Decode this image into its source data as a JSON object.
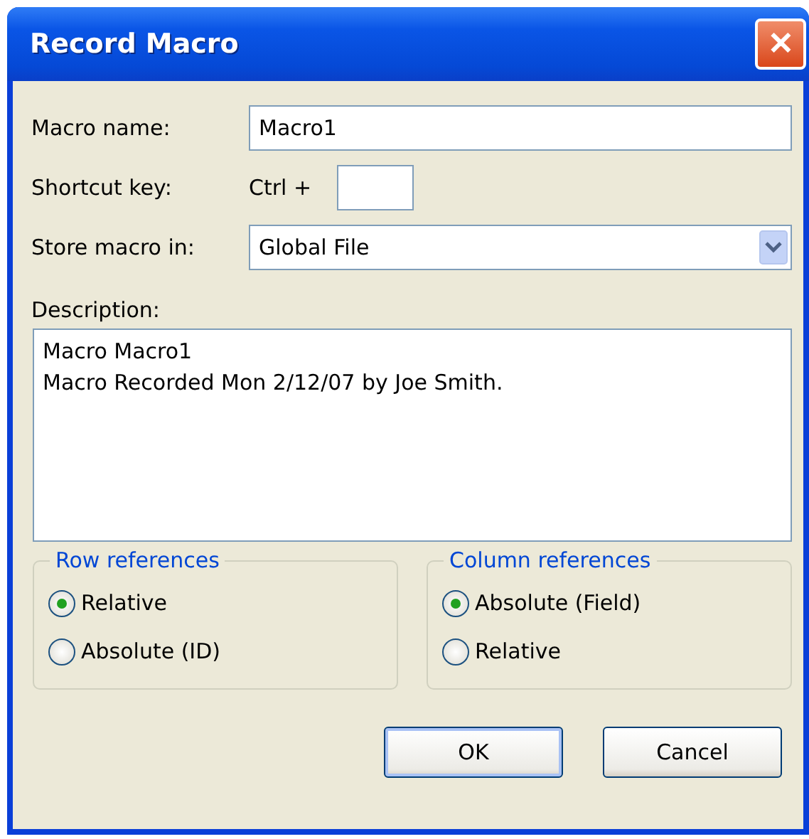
{
  "window": {
    "title": "Record Macro",
    "close": "✕"
  },
  "macro_name": {
    "label": "Macro name:",
    "value": "Macro1"
  },
  "shortcut_key": {
    "label": "Shortcut key:",
    "prefix": "Ctrl  +"
  },
  "store_macro_in": {
    "label": "Store macro in:",
    "value": "Global File"
  },
  "description": {
    "label": "Description:",
    "lines": [
      "Macro Macro1",
      "Macro Recorded Mon 2/12/07 by Joe Smith."
    ]
  },
  "groups": [
    {
      "title": "Row references",
      "options": [
        {
          "label": "Relative",
          "selected": true
        },
        {
          "label": "Absolute (ID)",
          "selected": false
        }
      ]
    },
    {
      "title": "Column references",
      "options": [
        {
          "label": "Absolute (Field)",
          "selected": true
        },
        {
          "label": "Relative",
          "selected": false
        }
      ]
    }
  ],
  "buttons": [
    {
      "label": "OK",
      "default": true
    },
    {
      "label": "Cancel",
      "default": false
    }
  ]
}
